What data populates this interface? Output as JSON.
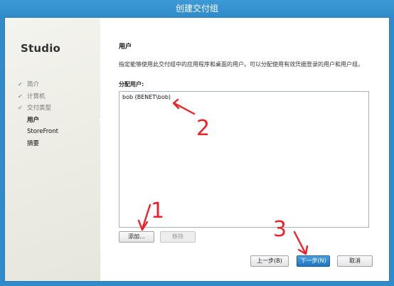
{
  "window": {
    "title": "创建交付组"
  },
  "sidebar": {
    "logo": "Studio",
    "steps": [
      {
        "label": "简介",
        "state": "done"
      },
      {
        "label": "计算机",
        "state": "done"
      },
      {
        "label": "交付类型",
        "state": "done"
      },
      {
        "label": "用户",
        "state": "current"
      },
      {
        "label": "StoreFront",
        "state": "future"
      },
      {
        "label": "摘要",
        "state": "future"
      }
    ],
    "check_glyph": "✔"
  },
  "main": {
    "title": "用户",
    "description": "指定能够使用此交付组中的应用程序和桌面的用户。可以分配使用有效凭据登录的用户和用户组。",
    "list_label": "分配用户:",
    "users": [
      "bob (BENET\\bob)"
    ],
    "add_label": "添加...",
    "remove_label": "移除"
  },
  "footer": {
    "back_label": "上一步(B)",
    "next_label": "下一步(N)",
    "cancel_label": "取消"
  },
  "annotations": {
    "color": "#e8242a",
    "labels": [
      "1",
      "2",
      "3"
    ]
  },
  "colors": {
    "window_border": "#2f8bc9",
    "primary_button": "#2a80c9"
  }
}
